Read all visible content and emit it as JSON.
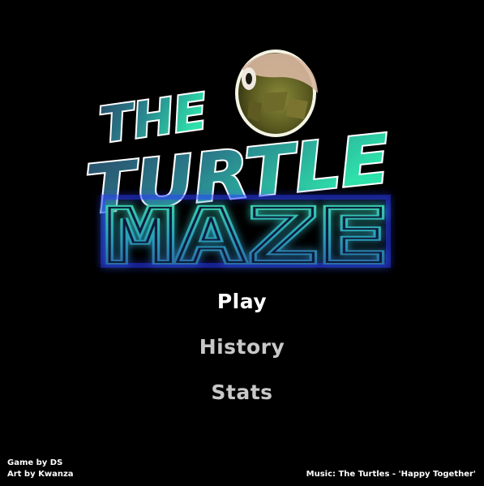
{
  "logo": {
    "line1": "THE",
    "line2": "TURTLE",
    "line3": "MAZE",
    "turtle_icon": "turtle-head-icon"
  },
  "menu": {
    "items": [
      {
        "label": "Play",
        "state": "highlighted"
      },
      {
        "label": "History",
        "state": "normal"
      },
      {
        "label": "Stats",
        "state": "normal"
      }
    ]
  },
  "credits": {
    "game_by": "Game by DS",
    "art_by": "Art by Kwanza",
    "music": "Music: The Turtles - 'Happy Together'"
  },
  "colors": {
    "background": "#000000",
    "menu_highlight": "#ffffff",
    "menu_normal": "#c8c8c8",
    "logo_top": "#2a4a68",
    "logo_bottom": "#27d0a6",
    "maze_glow": "#2a3cff"
  }
}
